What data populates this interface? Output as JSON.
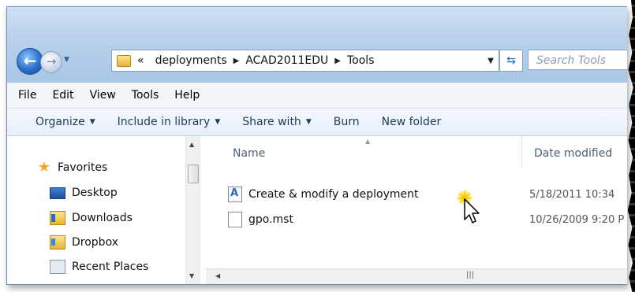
{
  "address_bar": {
    "overflow": "«",
    "crumbs": [
      "deployments",
      "ACAD2011EDU",
      "Tools"
    ]
  },
  "search": {
    "placeholder": "Search Tools"
  },
  "menu": [
    "File",
    "Edit",
    "View",
    "Tools",
    "Help"
  ],
  "toolbar": {
    "organize": "Organize",
    "include_in_library": "Include in library",
    "share_with": "Share with",
    "burn": "Burn",
    "new_folder": "New folder"
  },
  "sidebar": {
    "favorites": "Favorites",
    "items": [
      "Desktop",
      "Downloads",
      "Dropbox",
      "Recent Places"
    ]
  },
  "columns": {
    "name": "Name",
    "date_modified": "Date modified"
  },
  "files": [
    {
      "name": "Create & modify a deployment",
      "date": "5/18/2011 10:34"
    },
    {
      "name": "gpo.mst",
      "date": "10/26/2009 9:20 P"
    }
  ],
  "colors": {
    "accent": "#2f6ac2",
    "chrome": "#b9d1ec",
    "toolbar": "#e6eef8"
  }
}
